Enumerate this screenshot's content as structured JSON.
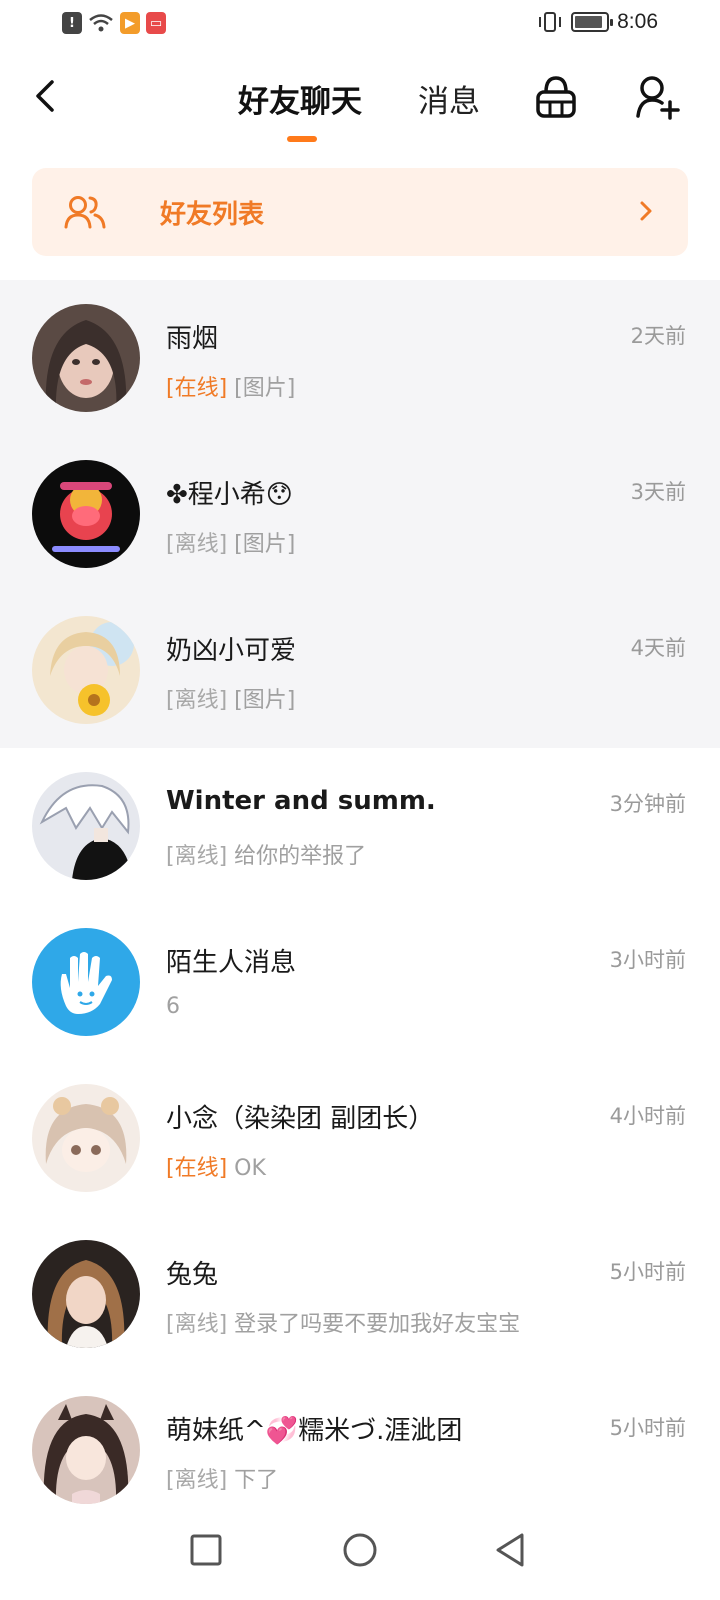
{
  "status_bar": {
    "time": "8:06",
    "icons": [
      "alert-icon",
      "wifi-icon",
      "video-app-icon",
      "tv-app-icon",
      "vibrate-icon",
      "battery-icon"
    ],
    "app_colors": {
      "alert": "#444444",
      "video": "#f39c2a",
      "tv": "#e84a4a"
    }
  },
  "header": {
    "tabs": [
      {
        "label": "好友聊天",
        "active": true
      },
      {
        "label": "消息",
        "active": false
      }
    ],
    "icons": [
      "back-icon",
      "basket-icon",
      "add-friend-icon"
    ]
  },
  "banner": {
    "label": "好友列表",
    "icon": "friends-icon"
  },
  "colors": {
    "accent": "#f07a26",
    "banner_bg": "#fff1e8",
    "pinned_bg": "#f5f5f7"
  },
  "conversations": [
    {
      "name": "雨烟",
      "time": "2天前",
      "status": "[在线]",
      "online": true,
      "message": "[图片]",
      "pinned": true
    },
    {
      "name": "✤程小希😯",
      "time": "3天前",
      "status": "[离线]",
      "online": false,
      "message": "[图片]",
      "pinned": true
    },
    {
      "name": "奶凶小可爱",
      "time": "4天前",
      "status": "[离线]",
      "online": false,
      "message": "[图片]",
      "pinned": true
    },
    {
      "name": "Winter and summ.",
      "time": "3分钟前",
      "status": "[离线]",
      "online": false,
      "message": "给你的举报了",
      "pinned": false
    },
    {
      "name": "陌生人消息",
      "time": "3小时前",
      "status": "",
      "online": false,
      "message": "6",
      "pinned": false
    },
    {
      "name": "小念（染染团  副团长）",
      "time": "4小时前",
      "status": "[在线]",
      "online": true,
      "message": "OK",
      "pinned": false
    },
    {
      "name": "兔兔",
      "time": "5小时前",
      "status": "[离线]",
      "online": false,
      "message": "登录了吗要不要加我好友宝宝",
      "pinned": false
    },
    {
      "name": "萌妹纸^💞糯米づ.涯泚团",
      "time": "5小时前",
      "status": "[离线]",
      "online": false,
      "message": "下了",
      "pinned": false
    }
  ],
  "nav_bar": {
    "icons": [
      "recent-apps-icon",
      "home-icon",
      "back-nav-icon"
    ]
  }
}
